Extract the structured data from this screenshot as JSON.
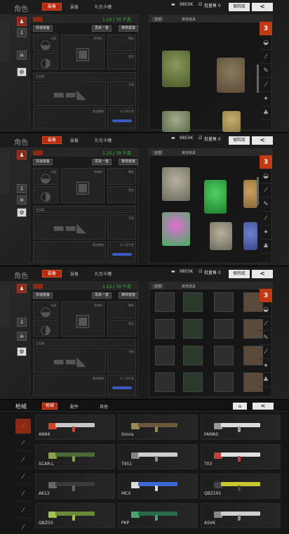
{
  "screens": [
    {
      "title": "角色",
      "tab_active": "装备",
      "tab2": "装备",
      "tab3": "礼包卡槽",
      "money": "9855K",
      "sell_count": "批量售 0",
      "warehouse": "保险库",
      "timer": "1.15 / 70 千克",
      "btn_auto": "快速装备",
      "btn_loadout": "再来一套",
      "btn_new": "推荐套装",
      "slot_helmet": "头盔",
      "slot_armor": "防弹衣",
      "slot_rig": "胸挂",
      "slot_bag": "背包",
      "slot_primary": "主武器",
      "slot_pistol": "手枪",
      "slot_melee": "近战",
      "weight_label": "背包携带",
      "r_tab1": "全部",
      "r_tab2": "其他道具",
      "weight2": "0 / 20千克"
    },
    {
      "title": "角色",
      "tab_active": "装备",
      "tab2": "装备",
      "tab3": "礼包卡槽",
      "money": "9855K",
      "sell_count": "批量售 0",
      "warehouse": "保险库",
      "timer": "1.15 / 70 千克",
      "btn_auto": "快速装备",
      "btn_loadout": "再来一套",
      "btn_new": "推荐套装",
      "slot_helmet": "头盔",
      "slot_armor": "防弹衣",
      "slot_rig": "胸挂",
      "slot_bag": "背包",
      "slot_primary": "主武器",
      "slot_pistol": "手枪",
      "slot_melee": "近战",
      "weight_label": "背包携带",
      "r_tab1": "全部",
      "r_tab2": "其他道具",
      "weight2": "0 / 20千克"
    },
    {
      "title": "角色",
      "tab_active": "装备",
      "tab2": "装备",
      "tab3": "礼包卡槽",
      "money": "9855K",
      "sell_count": "批量售 0",
      "warehouse": "保险库",
      "timer": "1.15 / 70 千克",
      "btn_auto": "快速装备",
      "btn_loadout": "再来一套",
      "btn_new": "推荐套装",
      "slot_helmet": "头盔",
      "slot_armor": "防弹衣",
      "slot_rig": "胸挂",
      "slot_bag": "背包",
      "slot_primary": "主武器",
      "slot_pistol": "手枪",
      "slot_melee": "近战",
      "weight_label": "背包携带",
      "r_tab1": "全部",
      "r_tab2": "其他道具",
      "weight2": "0 / 20千克"
    }
  ],
  "weapons_screen": {
    "title": "枪械",
    "tab_active": "枪械",
    "tab2": "配件",
    "tab3": "其他",
    "guns": [
      {
        "name": "AN94",
        "color": "#c8c8c8",
        "accent": "#d0402a"
      },
      {
        "name": "Groza",
        "color": "#6a5a3a",
        "accent": "#9a8a5a"
      },
      {
        "name": "FAMAS",
        "color": "#dcdcdc",
        "accent": "#999"
      },
      {
        "name": "SCAR-L",
        "color": "#4a6a3a",
        "accent": "#8aa04a"
      },
      {
        "name": "T951",
        "color": "#cfcfcf",
        "accent": "#888"
      },
      {
        "name": "T03",
        "color": "#e0e0e0",
        "accent": "#c04040"
      },
      {
        "name": "AK12",
        "color": "#3a3a3a",
        "accent": "#666"
      },
      {
        "name": "MCX",
        "color": "#3a6ad0",
        "accent": "#dcdcdc"
      },
      {
        "name": "QBZ191",
        "color": "#c8c832",
        "accent": "#444"
      },
      {
        "name": "QBZ03",
        "color": "#6a8a3a",
        "accent": "#a0c050"
      },
      {
        "name": "PKP",
        "color": "#2a6a4a",
        "accent": "#50a070"
      },
      {
        "name": "ASVK",
        "color": "#cfcfcf",
        "accent": "#888"
      }
    ]
  }
}
